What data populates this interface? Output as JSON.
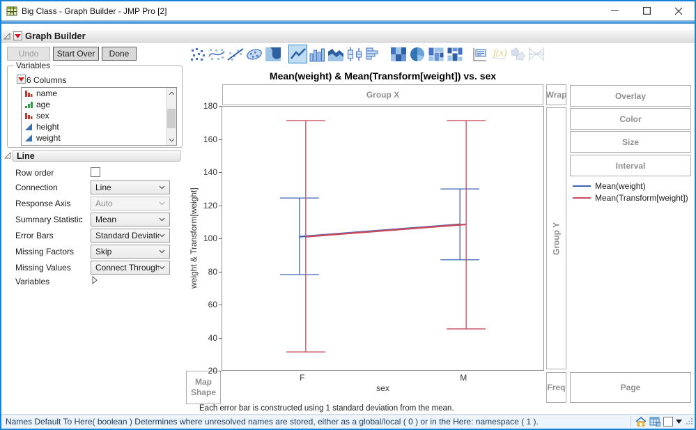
{
  "window": {
    "title": "Big Class - Graph Builder - JMP Pro [2]"
  },
  "outline": {
    "title": "Graph Builder"
  },
  "action_buttons": {
    "undo": "Undo",
    "start_over": "Start Over",
    "done": "Done"
  },
  "toolbar_icons": [
    "points",
    "smoother",
    "line-of-fit",
    "ellipse",
    "contour",
    "line",
    "bar",
    "area",
    "box-plot",
    "histogram",
    "heatmap",
    "pie",
    "treemap",
    "mosaic",
    "caption-box",
    "formula",
    "map-shapes",
    "parallel"
  ],
  "toolbar_selected": "line",
  "variables_panel": {
    "title": "Variables",
    "columns_label": "6 Columns",
    "items": [
      {
        "name": "name",
        "type": "nominal"
      },
      {
        "name": "age",
        "type": "ordinal"
      },
      {
        "name": "sex",
        "type": "nominal"
      },
      {
        "name": "height",
        "type": "continuous"
      },
      {
        "name": "weight",
        "type": "continuous"
      }
    ]
  },
  "line_panel": {
    "title": "Line",
    "rows": [
      {
        "label": "Row order",
        "type": "checkbox",
        "checked": false
      },
      {
        "label": "Connection",
        "type": "select",
        "value": "Line",
        "enabled": true
      },
      {
        "label": "Response Axis",
        "type": "select",
        "value": "Auto",
        "enabled": false
      },
      {
        "label": "Summary Statistic",
        "type": "select",
        "value": "Mean",
        "enabled": true
      },
      {
        "label": "Error Bars",
        "type": "select",
        "value": "Standard Deviatio",
        "enabled": true
      },
      {
        "label": "Missing Factors",
        "type": "select",
        "value": "Skip",
        "enabled": true
      },
      {
        "label": "Missing Values",
        "type": "select",
        "value": "Connect Through",
        "enabled": true
      },
      {
        "label": "Variables",
        "type": "disclosure"
      }
    ]
  },
  "drop_zones": {
    "group_x": "Group X",
    "wrap": "Wrap",
    "overlay": "Overlay",
    "color": "Color",
    "size": "Size",
    "interval": "Interval",
    "group_y": "Group Y",
    "map_shape": "Map Shape",
    "freq": "Freq",
    "page": "Page"
  },
  "chart_data": {
    "type": "line",
    "title": "Mean(weight) & Mean(Transform[weight]) vs. sex",
    "xlabel": "sex",
    "ylabel": "weight & Transform[weight]",
    "categories": [
      "F",
      "M"
    ],
    "ylim": [
      20,
      180
    ],
    "yticks": [
      20,
      40,
      60,
      80,
      100,
      120,
      140,
      160,
      180
    ],
    "grid": false,
    "legend_position": "right",
    "series": [
      {
        "name": "Mean(weight)",
        "color": "#3e64b8",
        "means": [
          101,
          108.5
        ],
        "sd_low": [
          78,
          87
        ],
        "sd_high": [
          124.5,
          130
        ]
      },
      {
        "name": "Mean(Transform[weight])",
        "color": "#c94a5c",
        "means": [
          101,
          108.5
        ],
        "sd_low": [
          31,
          45
        ],
        "sd_high": [
          171.5,
          171.5
        ]
      }
    ],
    "footnote": "Each error bar is constructed using 1 standard deviation from the mean."
  },
  "status_bar": {
    "text": "Names Default To Here( boolean )  Determines where unresolved names are stored, either as a global/local ( 0 ) or in the Here: namespace ( 1 )."
  },
  "colors": {
    "accent_blue": "#1583d7",
    "selected_icon_bg": "#bfddf3",
    "zone_text": "#8f8f8f",
    "series_blue": "#3e64b8",
    "series_red": "#c94a5c"
  }
}
